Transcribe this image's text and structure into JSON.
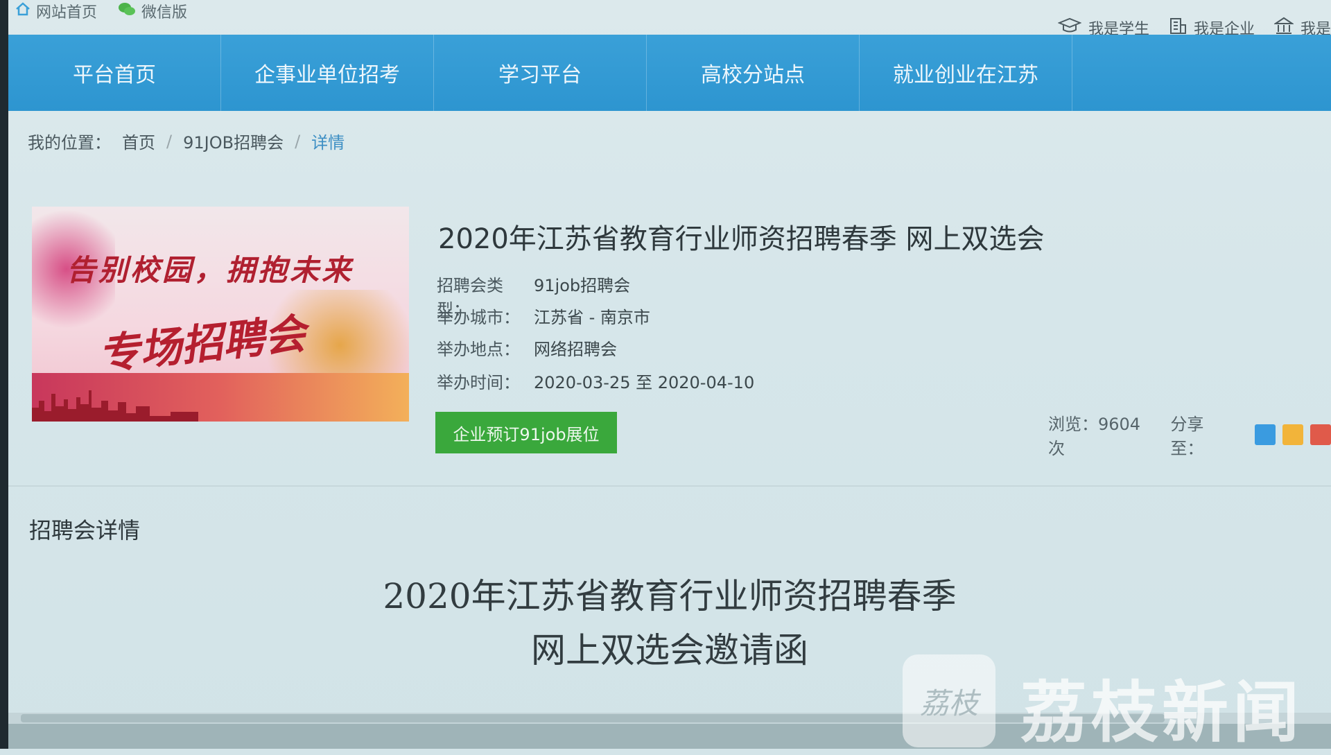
{
  "topbar": {
    "home_link": "网站首页",
    "wechat_link": "微信版",
    "student": "我是学生",
    "enterprise": "我是企业",
    "school": "我是"
  },
  "nav": {
    "items": [
      {
        "label": "平台首页"
      },
      {
        "label": "企事业单位招考"
      },
      {
        "label": "学习平台"
      },
      {
        "label": "高校分站点"
      },
      {
        "label": "就业创业在江苏"
      }
    ]
  },
  "breadcrumb": {
    "prefix": "我的位置：",
    "home": "首页",
    "level2": "91JOB招聘会",
    "current": "详情",
    "separator": "/"
  },
  "banner": {
    "line1": "告别校园，拥抱未来",
    "line2": "专场招聘会"
  },
  "event": {
    "title": "2020年江苏省教育行业师资招聘春季 网上双选会",
    "type_label": "招聘会类型：",
    "type_value": "91job招聘会",
    "city_label": "举办城市：",
    "city_value": "江苏省 - 南京市",
    "place_label": "举办地点：",
    "place_value": "网络招聘会",
    "time_label": "举办时间：",
    "time_value": "2020-03-25 至 2020-04-10",
    "book_button": "企业预订91job展位",
    "views": "浏览：9604次",
    "share_label": "分享至："
  },
  "details": {
    "section_title": "招聘会详情",
    "doc_title_line1": "2020年江苏省教育行业师资招聘春季",
    "doc_title_line2": "网上双选会邀请函"
  },
  "watermark": {
    "logo": "荔枝",
    "text": "荔枝新闻"
  },
  "colors": {
    "nav_bg": "#2d95d0",
    "button_green": "#3aa83c",
    "link_blue": "#3d8fc4"
  }
}
